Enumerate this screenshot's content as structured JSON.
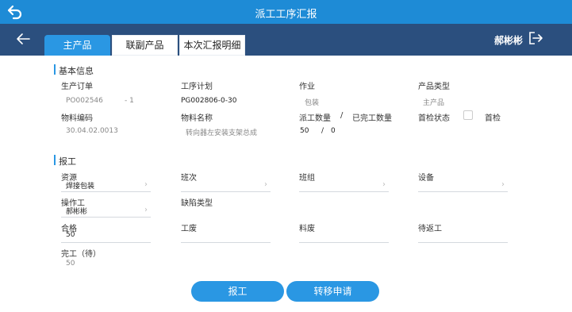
{
  "header": {
    "title": "派工工序汇报",
    "back_icon": "back-arrow-icon"
  },
  "nav": {
    "back_icon": "left-arrow-icon",
    "tabs": [
      "主产品",
      "联副产品",
      "本次汇报明细"
    ],
    "user": "郝彬彬",
    "logout_icon": "logout-icon"
  },
  "basic": {
    "section": "基本信息",
    "order_label": "生产订单",
    "order_value": "PO002546",
    "order_line": "- 1",
    "plan_label": "工序计划",
    "plan_value": "PG002806-0-30",
    "job_label": "作业",
    "job_value": "包装",
    "ptype_label": "产品类型",
    "ptype_value": "主产品",
    "mcode_label": "物料编码",
    "mcode_value": "30.04.02.0013",
    "mname_label": "物料名称",
    "mname_value": "转向器左安装支架总成",
    "qty_label": "派工数量",
    "slash1": "/",
    "done_label": "已完工数量",
    "qty_value": "50",
    "slash2": "/",
    "done_value": "0",
    "check_label": "首检状态",
    "check_text": "首检"
  },
  "report": {
    "section": "报工",
    "resource_label": "资源",
    "resource_value": "焊接包装",
    "shift_label": "班次",
    "team_label": "班组",
    "device_label": "设备",
    "operator_label": "操作工",
    "operator_value": "郝彬彬",
    "defect_label": "缺陷类型",
    "ok_label": "合格",
    "ok_value": "50",
    "scrap_label": "工废",
    "mscrap_label": "料废",
    "rework_label": "待返工",
    "complete_label": "完工（待）",
    "complete_value": "50"
  },
  "buttons": {
    "report": "报工",
    "transfer": "转移申请"
  },
  "colors": {
    "header": "#1e8bd6",
    "tabbar": "#2b4f7e",
    "accent": "#2a97e3"
  }
}
